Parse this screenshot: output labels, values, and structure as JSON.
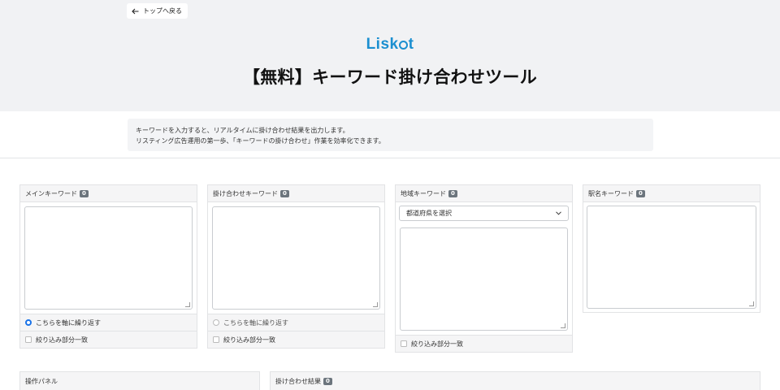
{
  "header": {
    "back_label": "トップへ戻る",
    "logo_prefix": "Lisk",
    "logo_suffix": "t",
    "title": "【無料】キーワード掛け合わせツール"
  },
  "description": {
    "line1": "キーワードを入力すると、リアルタイムに掛け合わせ結果を出力します。",
    "line2": "リスティング広告運用の第一歩、「キーワードの掛け合わせ」作業を効率化できます。"
  },
  "panels": {
    "main": {
      "title": "メインキーワード",
      "count": "0",
      "repeat_label": "こちらを軸に繰り返す",
      "repeat_selected": true,
      "match_label": "絞り込み部分一致"
    },
    "combo": {
      "title": "掛け合わせキーワード",
      "count": "0",
      "repeat_label": "こちらを軸に繰り返す",
      "repeat_selected": false,
      "match_label": "絞り込み部分一致"
    },
    "region": {
      "title": "地域キーワード",
      "count": "0",
      "select_value": "都道府県を選択",
      "match_label": "絞り込み部分一致"
    },
    "station": {
      "title": "駅名キーワード",
      "count": "0"
    }
  },
  "bottom": {
    "operation_title": "操作パネル",
    "result_title": "掛け合わせ結果",
    "result_count": "0"
  },
  "colors": {
    "brand": "#1b8fd0",
    "radio_active": "#1a73e8",
    "badge": "#6c757d"
  }
}
